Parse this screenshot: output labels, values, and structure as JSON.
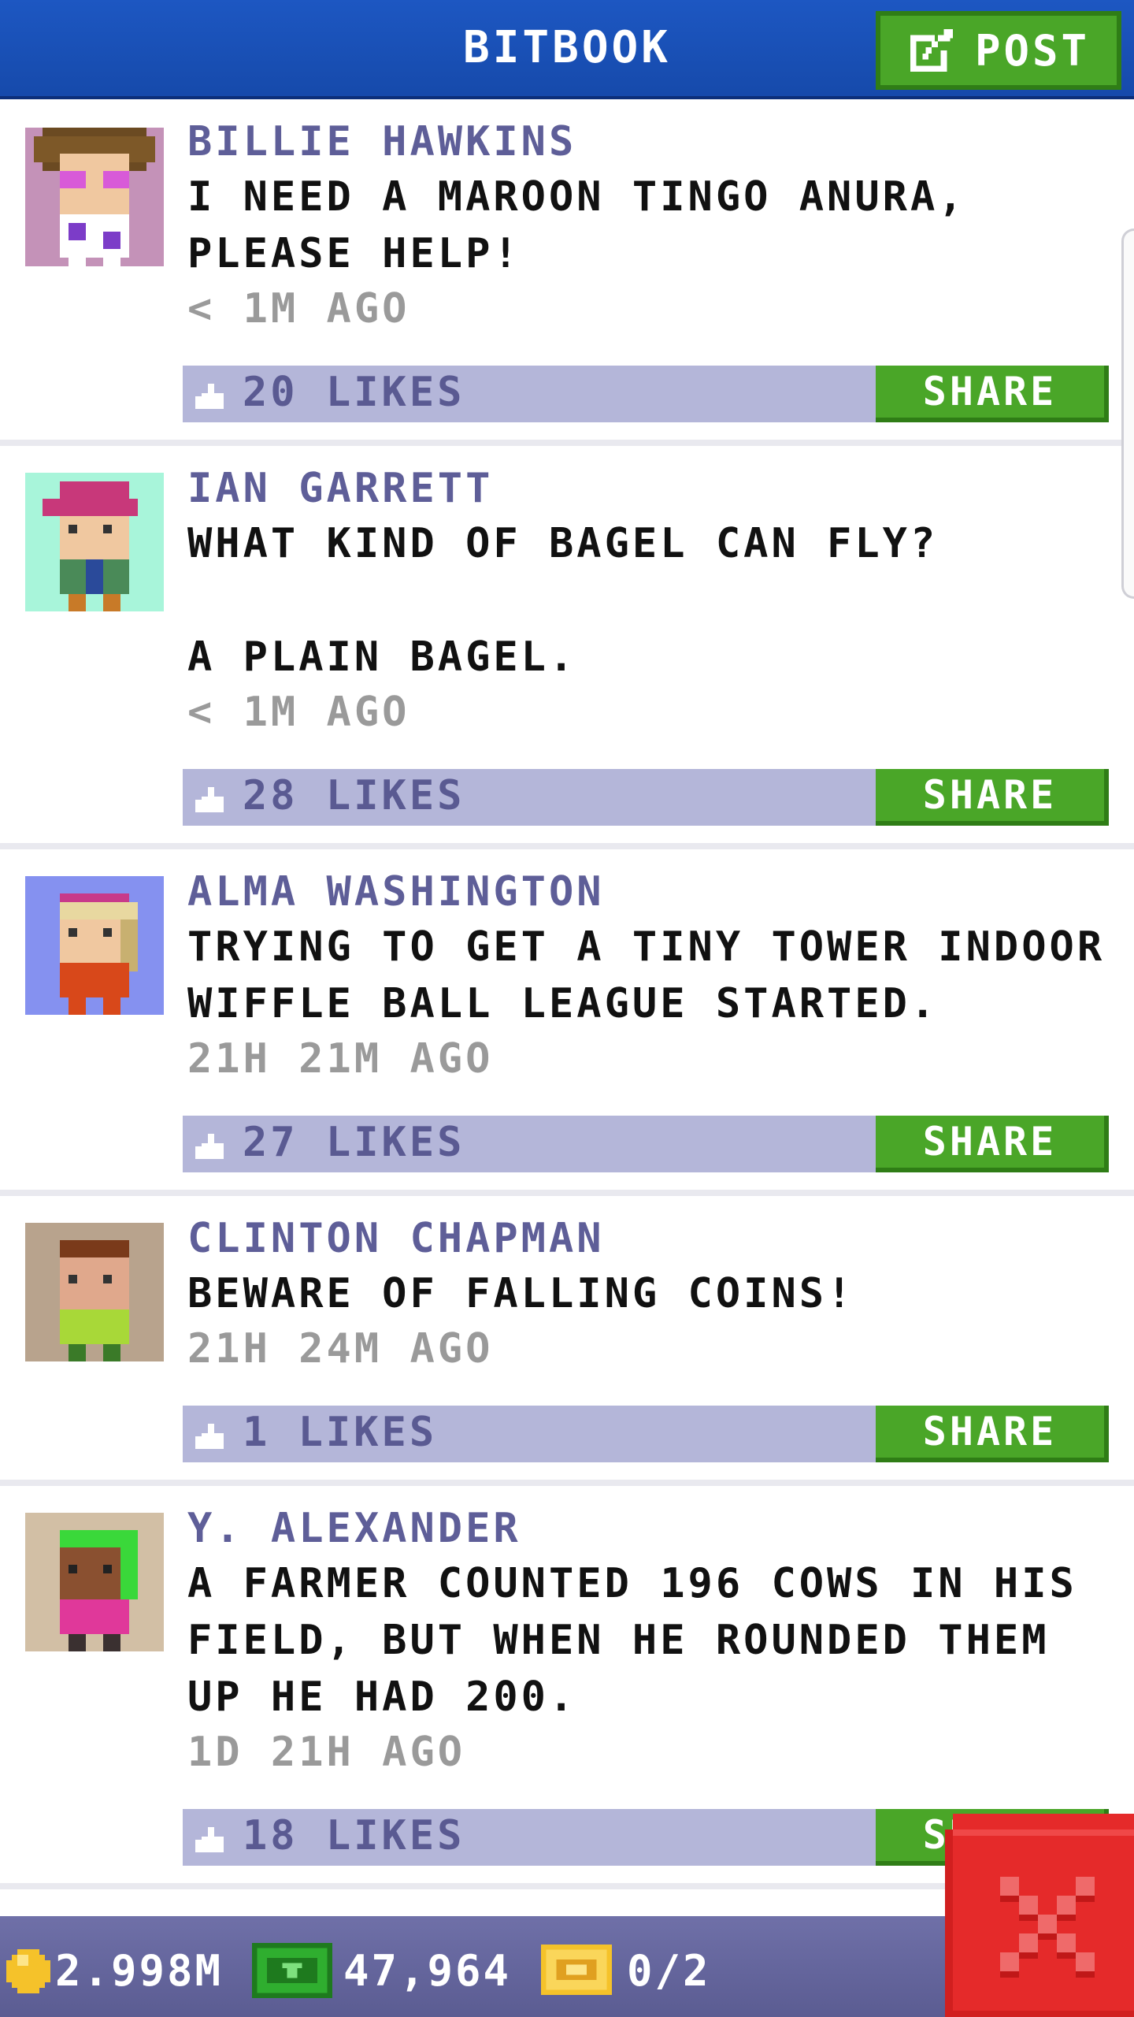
{
  "header": {
    "title": "BITBOOK",
    "post_label": "POST",
    "post_icon": "edit-icon"
  },
  "posts": [
    {
      "author": "BILLIE HAWKINS",
      "message": "I NEED A MAROON TINGO ANURA, PLEASE HELP!",
      "time": "< 1M AGO",
      "likes": "20 LIKES",
      "share_label": "SHARE",
      "avatar_bg": "#c492b8"
    },
    {
      "author": "IAN GARRETT",
      "message": "WHAT KIND OF BAGEL CAN FLY?\n\nA PLAIN BAGEL.",
      "time": "< 1M AGO",
      "likes": "28 LIKES",
      "share_label": "SHARE",
      "avatar_bg": "#a8f5da"
    },
    {
      "author": "ALMA WASHINGTON",
      "message": "TRYING TO GET A TINY TOWER INDOOR WIFFLE BALL LEAGUE STARTED.",
      "time": "21H 21M AGO",
      "likes": "27 LIKES",
      "share_label": "SHARE",
      "avatar_bg": "#8591f0"
    },
    {
      "author": "CLINTON CHAPMAN",
      "message": "BEWARE OF FALLING COINS!",
      "time": "21H 24M AGO",
      "likes": "1 LIKES",
      "share_label": "SHARE",
      "avatar_bg": "#b8a38d"
    },
    {
      "author": "Y. ALEXANDER",
      "message": "A FARMER COUNTED 196 COWS IN HIS FIELD, BUT WHEN HE ROUNDED THEM UP HE HAD 200.",
      "time": "1D 21H AGO",
      "likes": "18 LIKES",
      "share_label": "SHARE",
      "avatar_bg": "#d2bfa5"
    }
  ],
  "status_bar": {
    "coins": "2.998M",
    "bux": "47,964",
    "tickets": "0/2"
  },
  "colors": {
    "header_blue": "#1d57c2",
    "button_green": "#4aa628",
    "like_bar": "#b4b6d9",
    "author_text": "#5e5e98",
    "close_red": "#e52a2a"
  }
}
